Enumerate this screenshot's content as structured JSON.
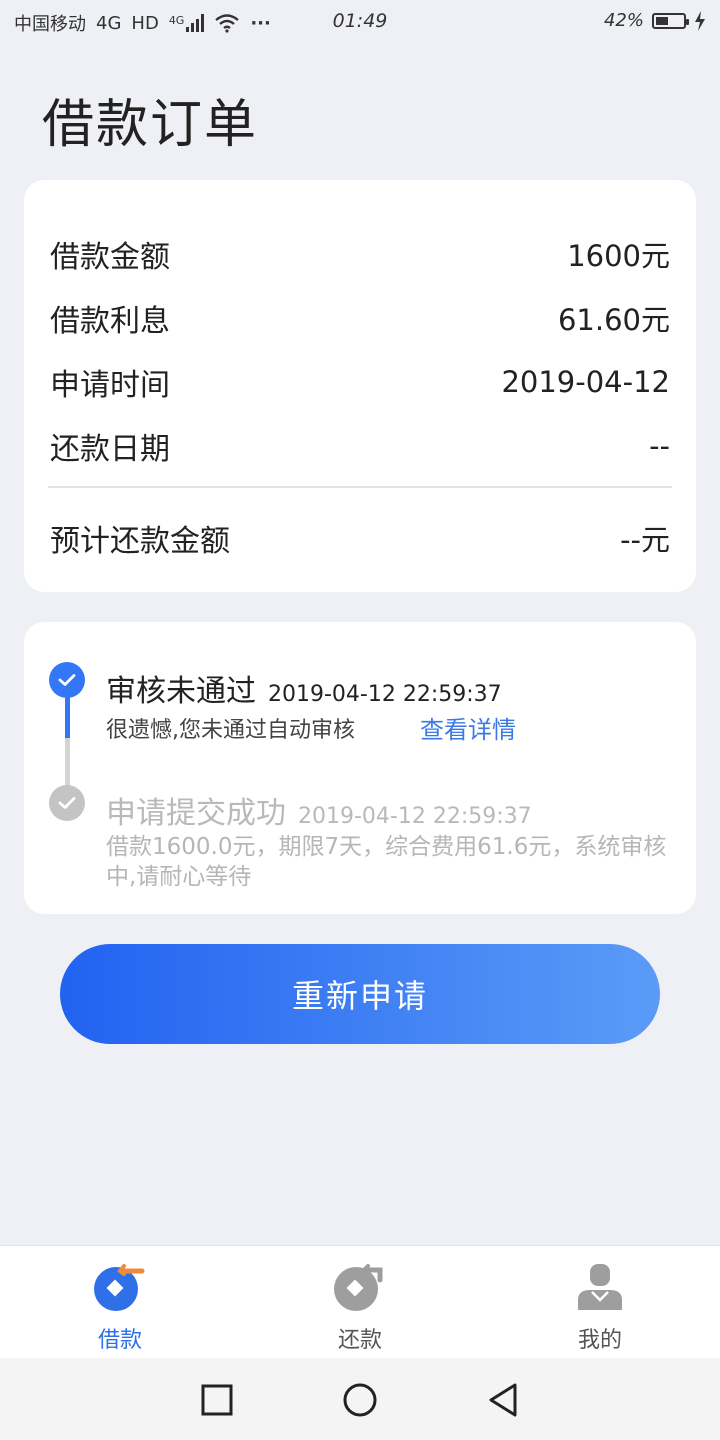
{
  "status_bar": {
    "carrier": "中国移动",
    "network": "4G",
    "hd": "HD",
    "signal_label": "4G",
    "dots": "···",
    "time": "01:49",
    "battery": "42%"
  },
  "title": "借款订单",
  "order_info": {
    "rows": [
      {
        "label": "借款金额",
        "value": "1600元"
      },
      {
        "label": "借款利息",
        "value": "61.60元"
      },
      {
        "label": "申请时间",
        "value": "2019-04-12"
      },
      {
        "label": "还款日期",
        "value": "--"
      }
    ],
    "total": {
      "label": "预计还款金额",
      "value": "--元"
    }
  },
  "timeline": [
    {
      "title": "审核未通过",
      "time": "2019-04-12 22:59:37",
      "desc": "很遗憾,您未通过自动审核",
      "link": "查看详情"
    },
    {
      "title": "申请提交成功",
      "time": "2019-04-12 22:59:37",
      "desc": "借款1600.0元，期限7天，综合费用61.6元，系统审核中,请耐心等待"
    }
  ],
  "reapply_button": "重新申请",
  "tabs": [
    {
      "label": "借款",
      "icon": "loan-icon",
      "active": true
    },
    {
      "label": "还款",
      "icon": "repay-icon",
      "active": false
    },
    {
      "label": "我的",
      "icon": "profile-icon",
      "active": false
    }
  ],
  "colors": {
    "primary": "#3477f6",
    "link": "#3b7ae6",
    "accent_orange": "#f08a3c",
    "background": "#eef0f5"
  }
}
